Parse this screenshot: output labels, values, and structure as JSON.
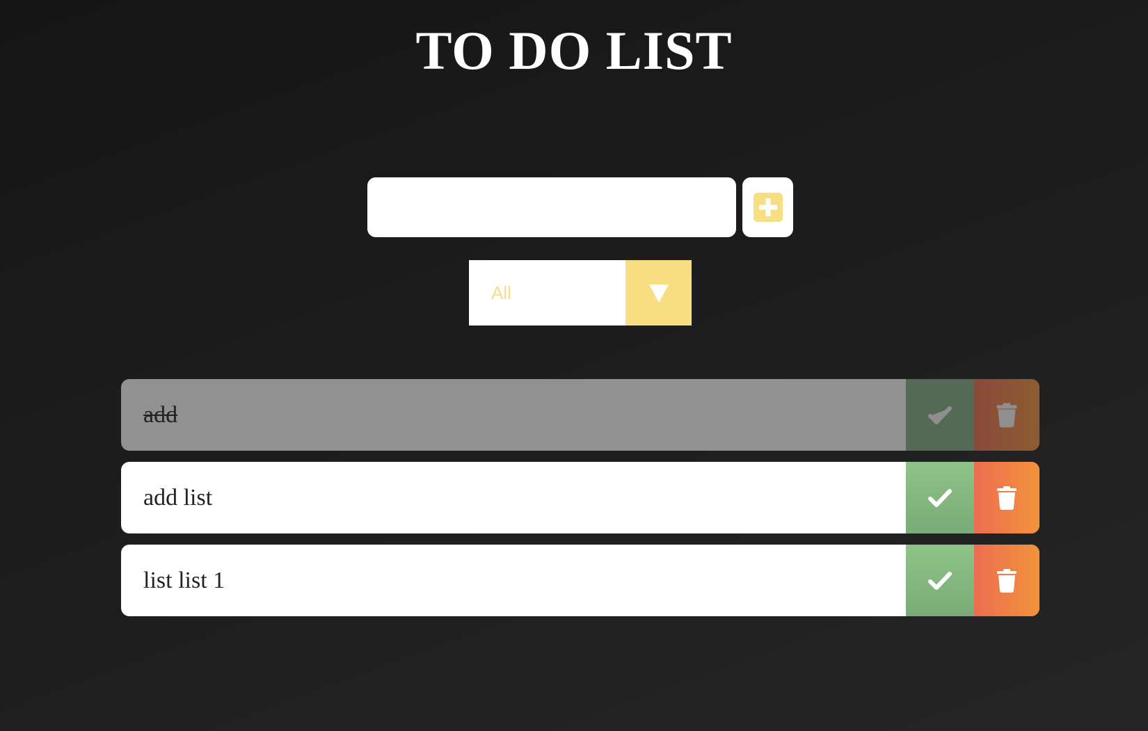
{
  "header": {
    "title": "TO DO LIST"
  },
  "form": {
    "input_value": "",
    "input_placeholder": "",
    "add_icon": "plus-square-icon"
  },
  "filter": {
    "selected": "All",
    "arrow_icon": "triangle-down-icon"
  },
  "todos": [
    {
      "text": "add",
      "completed": true
    },
    {
      "text": "add list",
      "completed": false
    },
    {
      "text": "list list 1",
      "completed": false
    }
  ],
  "icons": {
    "complete": "check-icon",
    "delete": "trash-icon"
  },
  "colors": {
    "background": "#1a1a1a",
    "accent": "#f8de82",
    "complete": "#8ec489",
    "delete_start": "#ec6d50",
    "delete_end": "#f2923b",
    "completed_item": "#919191"
  }
}
